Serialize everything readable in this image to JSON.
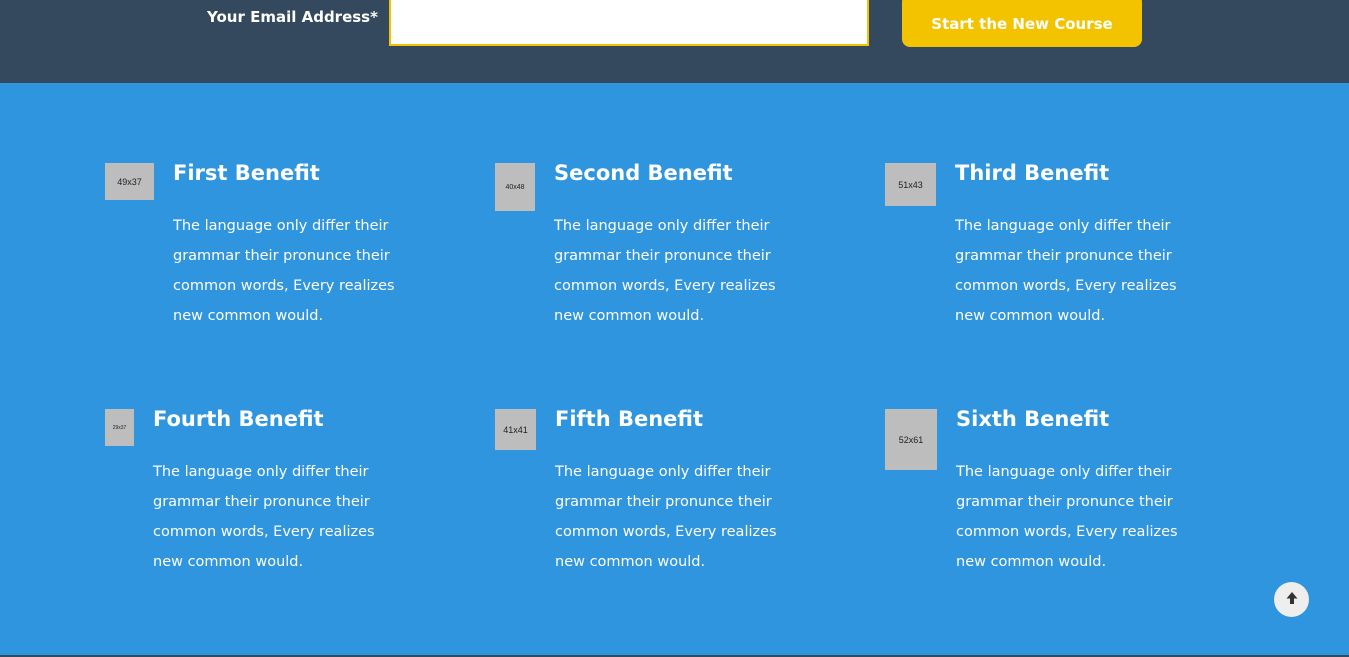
{
  "signup": {
    "email_label": "Your Email Address*",
    "email_value": "",
    "email_placeholder": "",
    "button_label": "Start the New Course"
  },
  "benefits": [
    {
      "title": "First Benefit",
      "image_label": "49x37",
      "text": "The language only differ their grammar their pronunce their common words, Every realizes new common would."
    },
    {
      "title": "Second Benefit",
      "image_label": "40x48",
      "text": "The language only differ their grammar their pronunce their common words, Every realizes new common would."
    },
    {
      "title": "Third Benefit",
      "image_label": "51x43",
      "text": "The language only differ their grammar their pronunce their common words, Every realizes new common would."
    },
    {
      "title": "Fourth Benefit",
      "image_label": "29x37",
      "text": "The language only differ their grammar their pronunce their common words, Every realizes new common would."
    },
    {
      "title": "Fifth Benefit",
      "image_label": "41x41",
      "text": "The language only differ their grammar their pronunce their common words, Every realizes new common would."
    },
    {
      "title": "Sixth Benefit",
      "image_label": "52x61",
      "text": "The language only differ their grammar their pronunce their common words, Every realizes new common would."
    }
  ],
  "icons": {
    "scroll_top": "arrow-up-icon"
  },
  "colors": {
    "header_bg": "#34495e",
    "section_bg": "#2e95de",
    "accent": "#f3c300",
    "text": "#ffffff"
  }
}
